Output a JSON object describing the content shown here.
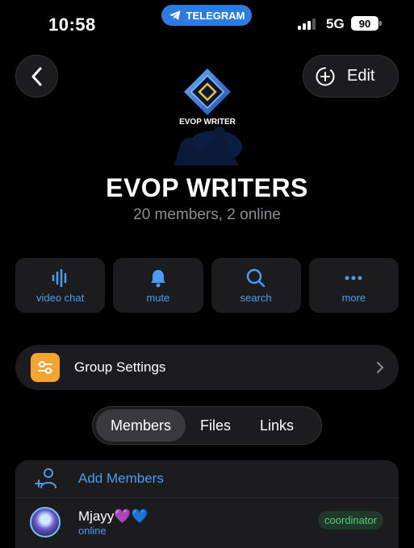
{
  "status_bar": {
    "time": "10:58",
    "app_pill": "TELEGRAM",
    "network": "5G",
    "battery": "90"
  },
  "header": {
    "edit_label": "Edit",
    "icons": [
      "back-chevron-icon",
      "add-circle-icon"
    ]
  },
  "group": {
    "logo_text": "EVOP WRITER",
    "title": "EVOP WRITERS",
    "subtitle": "20 members, 2 online"
  },
  "actions": [
    {
      "label": "video chat",
      "icon": "video-chat-icon"
    },
    {
      "label": "mute",
      "icon": "bell-icon"
    },
    {
      "label": "search",
      "icon": "search-icon"
    },
    {
      "label": "more",
      "icon": "more-icon"
    }
  ],
  "settings": {
    "label": "Group Settings",
    "icon": "settings-sliders-icon"
  },
  "tabs": [
    {
      "label": "Members",
      "active": true
    },
    {
      "label": "Files",
      "active": false
    },
    {
      "label": "Links",
      "active": false
    }
  ],
  "members": {
    "add_label": "Add Members",
    "list": [
      {
        "name": "Mjayy💜💙",
        "status": "online",
        "role": "coordinator"
      }
    ]
  },
  "colors": {
    "accent": "#4b9cf0",
    "pill": "#2b7be0",
    "settings_icon_bg": "#f4a531",
    "badge_text": "#5cc97a"
  }
}
